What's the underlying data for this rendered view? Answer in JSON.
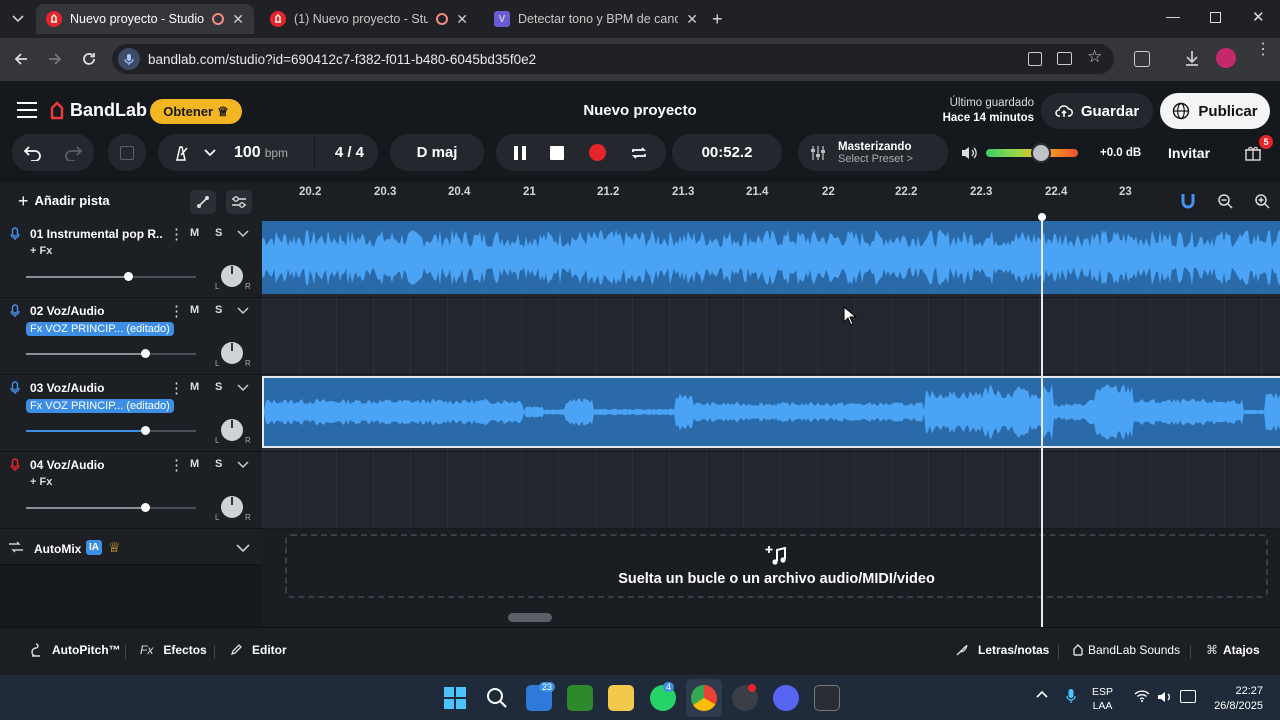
{
  "browser": {
    "tabs": [
      {
        "title": "Nuevo proyecto - Studio",
        "icon": "bandlab-icon",
        "active": true
      },
      {
        "title": "(1) Nuevo proyecto - Studio",
        "icon": "bandlab-icon",
        "active": false
      },
      {
        "title": "Detectar tono y BPM de canció",
        "icon": "v-icon",
        "active": false
      }
    ],
    "url": "bandlab.com/studio?id=690412c7-f382-f011-b480-6045bd35f0e2"
  },
  "header": {
    "logo_text": "BandLab",
    "obtener_label": "Obtener",
    "project_title": "Nuevo proyecto",
    "last_saved_label": "Último guardado",
    "last_saved_time": "Hace 14 minutos",
    "save_label": "Guardar",
    "publish_label": "Publicar"
  },
  "transport": {
    "bpm_value": "100",
    "bpm_unit": "bpm",
    "time_sig": "4 / 4",
    "key": "D maj",
    "time": "00:52.2",
    "mastering_title": "Masterizando",
    "mastering_preset": "Select Preset >",
    "volume_db": "+0.0 dB",
    "volume_level": 0.6,
    "invite_label": "Invitar",
    "notification_count": "5"
  },
  "left_panel": {
    "add_track_label": "Añadir pista",
    "automix_label": "AutoMix",
    "ia_badge": "IA"
  },
  "ruler": {
    "ticks": [
      "20.2",
      "20.3",
      "20.4",
      "21",
      "21.2",
      "21.3",
      "21.4",
      "22",
      "22.2",
      "22.3",
      "22.4",
      "23"
    ]
  },
  "tracks": [
    {
      "name": "01  Instrumental pop R...",
      "fx": "+ Fx",
      "m": "M",
      "s": "S",
      "volume": 0.6,
      "edited": false
    },
    {
      "name": "02  Voz/Audio",
      "fx": "Fx VOZ PRINCIP... (editado)",
      "m": "M",
      "s": "S",
      "volume": 0.7,
      "edited": true
    },
    {
      "name": "03  Voz/Audio",
      "fx": "Fx VOZ PRINCIP... (editado)",
      "m": "M",
      "s": "S",
      "volume": 0.7,
      "edited": true
    },
    {
      "name": "04  Voz/Audio",
      "fx": "+ Fx",
      "m": "M",
      "s": "S",
      "volume": 0.7,
      "edited": false
    }
  ],
  "knob_labels": {
    "l": "L",
    "r": "R"
  },
  "drop_zone": {
    "text": "Suelta un bucle o un archivo audio/MIDI/video"
  },
  "bottom_bar": {
    "autopitch": "AutoPitch™",
    "effects": "Efectos",
    "effects_prefix": "Fx",
    "editor": "Editor",
    "lyrics": "Letras/notas",
    "sounds": "BandLab Sounds",
    "shortcuts": "Atajos"
  },
  "taskbar": {
    "lang": "ESP",
    "lang_sub": "LAA",
    "time": "22:27",
    "date": "26/8/2025",
    "badges": [
      "23",
      "4"
    ]
  },
  "colors": {
    "accent": "#3d8fe6",
    "record": "#e8242b",
    "brand": "#f03a3a",
    "obtener": "#f2b524"
  }
}
